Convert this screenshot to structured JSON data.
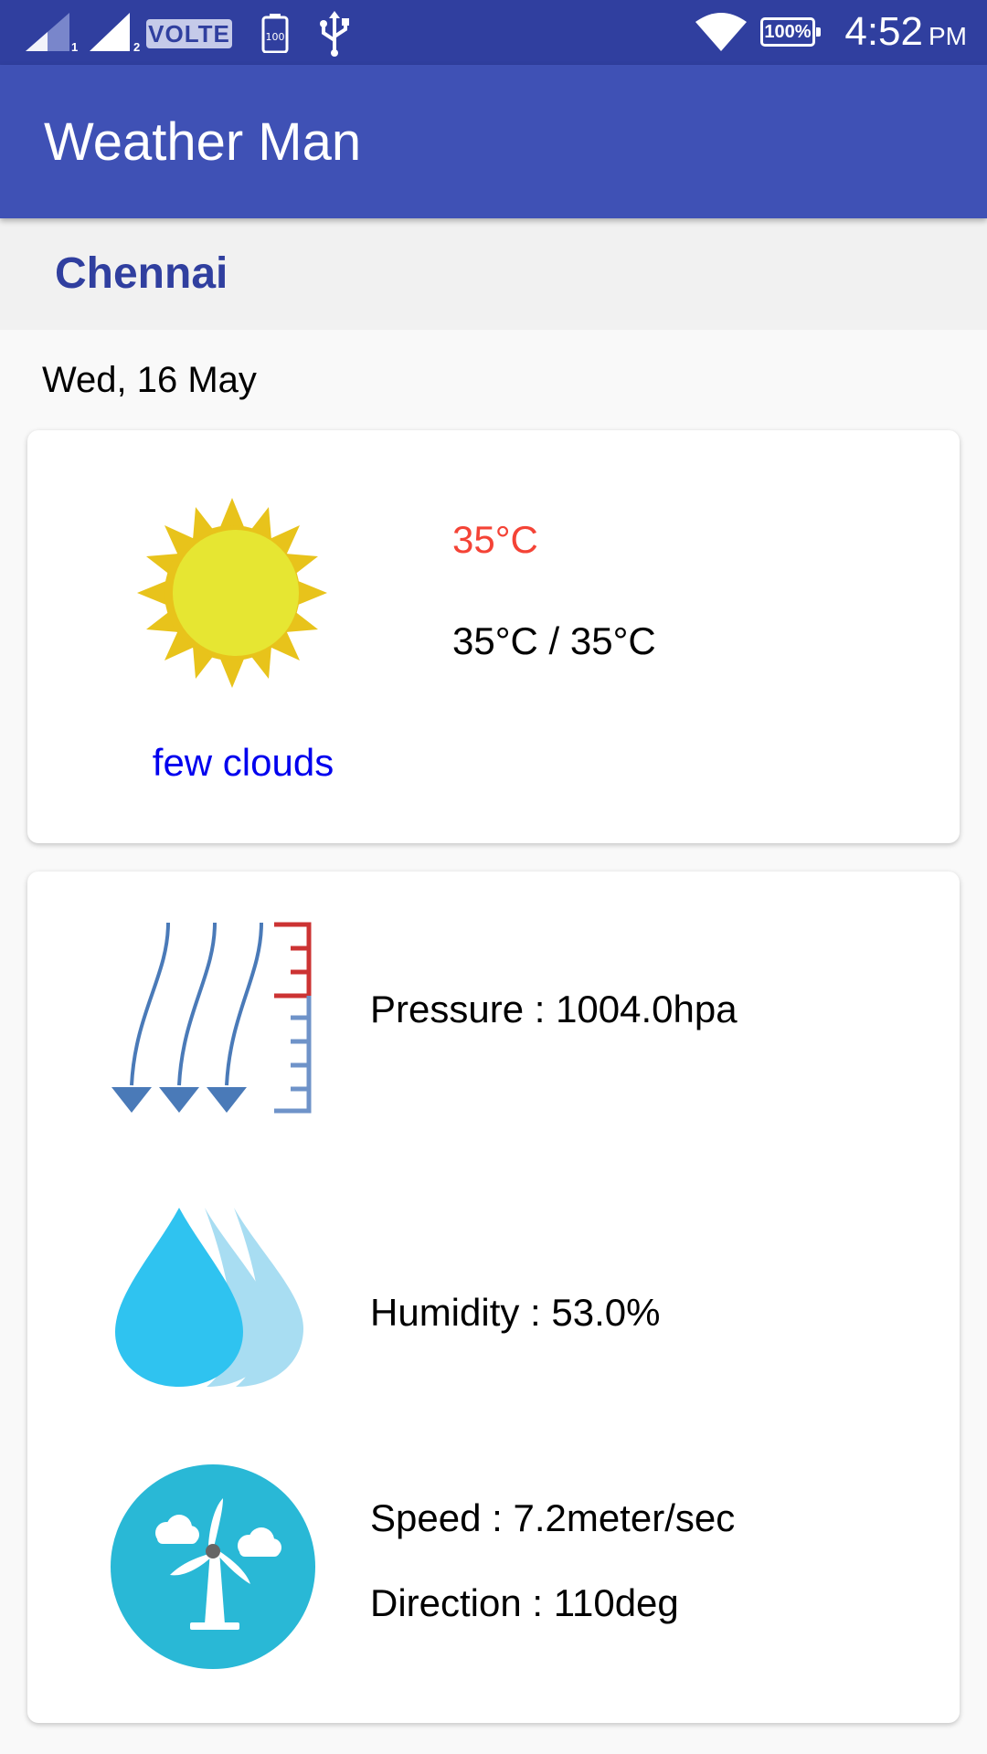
{
  "status_bar": {
    "sim1": "1",
    "sim2": "2",
    "volte": "VOLTE",
    "battery_small": "100",
    "battery_percent": "100%",
    "time": "4:52",
    "ampm": "PM"
  },
  "app": {
    "title": "Weather Man"
  },
  "location": {
    "city": "Chennai"
  },
  "forecast": {
    "date": "Wed, 16 May",
    "temperature": "35°C",
    "range": "35°C / 35°C",
    "description": "few clouds"
  },
  "details": {
    "pressure": "Pressure : 1004.0hpa",
    "humidity": "Humidity : 53.0%",
    "speed": "Speed : 7.2meter/sec",
    "direction": "Direction : 110deg"
  },
  "colors": {
    "status_bar": "#303f9f",
    "app_bar": "#3f51b5",
    "city": "#303f9f",
    "temperature": "#f44336",
    "description": "#0000ee"
  },
  "icons": [
    "signal-icon",
    "usb-icon",
    "wifi-icon",
    "battery-icon",
    "sun-icon",
    "pressure-icon",
    "humidity-icon",
    "wind-turbine-icon"
  ]
}
